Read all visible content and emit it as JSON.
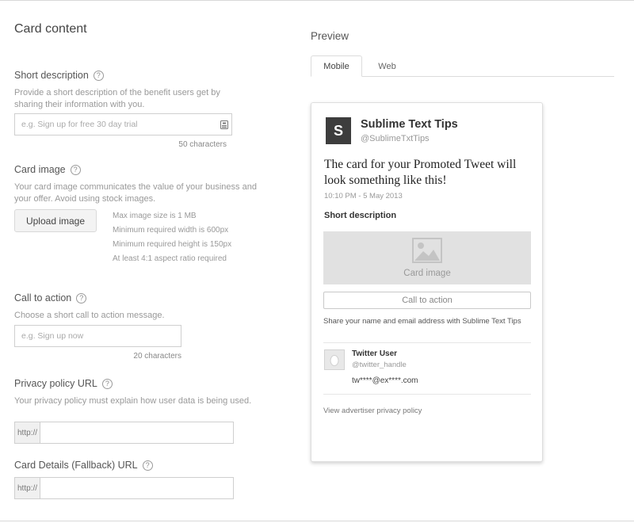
{
  "left": {
    "title": "Card content",
    "short_description": {
      "label": "Short description",
      "help": "?",
      "description": "Provide a short description of the benefit users get by sharing their information with you.",
      "placeholder": "e.g. Sign up for free 30 day trial",
      "counter": "50 characters"
    },
    "card_image": {
      "label": "Card image",
      "help": "?",
      "description": "Your card image communicates the value of your business and your offer. Avoid using stock images.",
      "button": "Upload image",
      "requirements": [
        "Max image size is 1 MB",
        "Minimum required width is 600px",
        "Minimum required height is 150px",
        "At least 4:1 aspect ratio required"
      ]
    },
    "call_to_action": {
      "label": "Call to action",
      "help": "?",
      "description": "Choose a short call to action message.",
      "placeholder": "e.g. Sign up now",
      "counter": "20 characters"
    },
    "privacy_policy": {
      "label": "Privacy policy URL",
      "help": "?",
      "description": "Your privacy policy must explain how user data is being used.",
      "prefix": "http://"
    },
    "fallback_url": {
      "label": "Card Details (Fallback) URL",
      "help": "?",
      "prefix": "http://"
    }
  },
  "preview": {
    "title": "Preview",
    "tabs": [
      {
        "label": "Mobile",
        "active": true
      },
      {
        "label": "Web",
        "active": false
      }
    ],
    "card": {
      "avatar_letter": "S",
      "account_name": "Sublime Text Tips",
      "account_handle": "@SublimeTxtTips",
      "tweet_text": "The card for your Promoted Tweet will look something like this!",
      "timestamp": "10:10 PM - 5 May 2013",
      "short_description": "Short description",
      "image_label": "Card image",
      "cta": "Call to action",
      "share_text": "Share your name and email address with Sublime Text Tips",
      "user_name": "Twitter User",
      "user_handle": "@twitter_handle",
      "user_email": "tw****@ex****.com",
      "privacy_link": "View advertiser privacy policy"
    }
  },
  "icons": {
    "help": "question-circle-icon",
    "input_action": "contact-card-icon",
    "image_placeholder": "image-icon",
    "user_avatar": "egg-avatar-icon"
  },
  "colors": {
    "avatar_bg": "#3d3d3d",
    "image_box_bg": "#e1e1e1"
  }
}
